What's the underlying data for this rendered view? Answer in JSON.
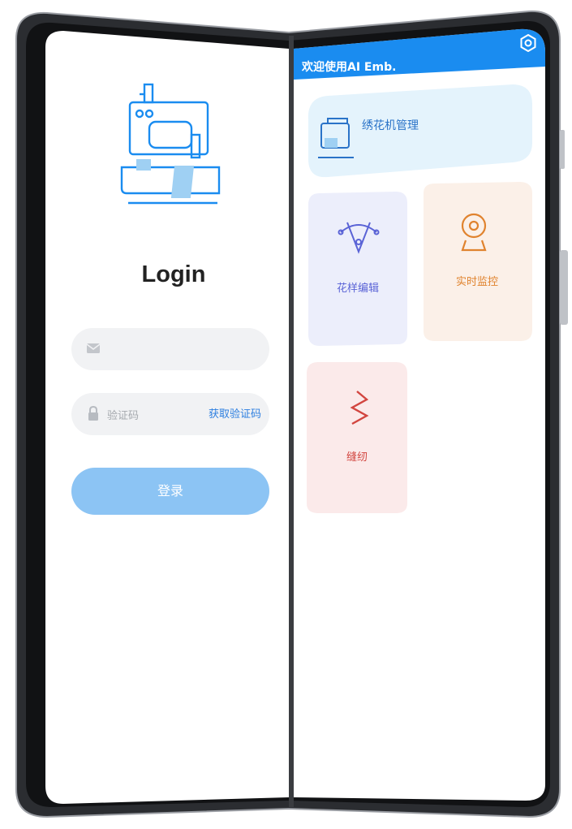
{
  "login_panel": {
    "title": "Login",
    "email_field": {
      "value": "",
      "icon": "mail-icon"
    },
    "code_field": {
      "placeholder": "验证码",
      "get_code_label": "获取验证码",
      "icon": "lock-icon"
    },
    "login_button_label": "登录",
    "illustration": "sewing-machine-icon"
  },
  "home_panel": {
    "header_text": "欢迎使用AI Emb.",
    "settings_icon": "settings-icon",
    "cards": [
      {
        "label": "绣花机管理",
        "icon": "sewing-machine-icon",
        "color": "#2a73c8",
        "bg": "#e4f3fc"
      },
      {
        "label": "花样编辑",
        "icon": "pen-tool-icon",
        "color": "#5a63d6",
        "bg": "#eceefb"
      },
      {
        "label": "实时监控",
        "icon": "webcam-icon",
        "color": "#e0832e",
        "bg": "#fbf0e8"
      },
      {
        "label": "缝纫",
        "icon": "zigzag-stitch-icon",
        "color": "#d2453f",
        "bg": "#fbeaea"
      }
    ]
  },
  "colors": {
    "accent_blue": "#1a8cf0",
    "login_button": "#8cc4f4",
    "frame": "#2a2c30"
  }
}
